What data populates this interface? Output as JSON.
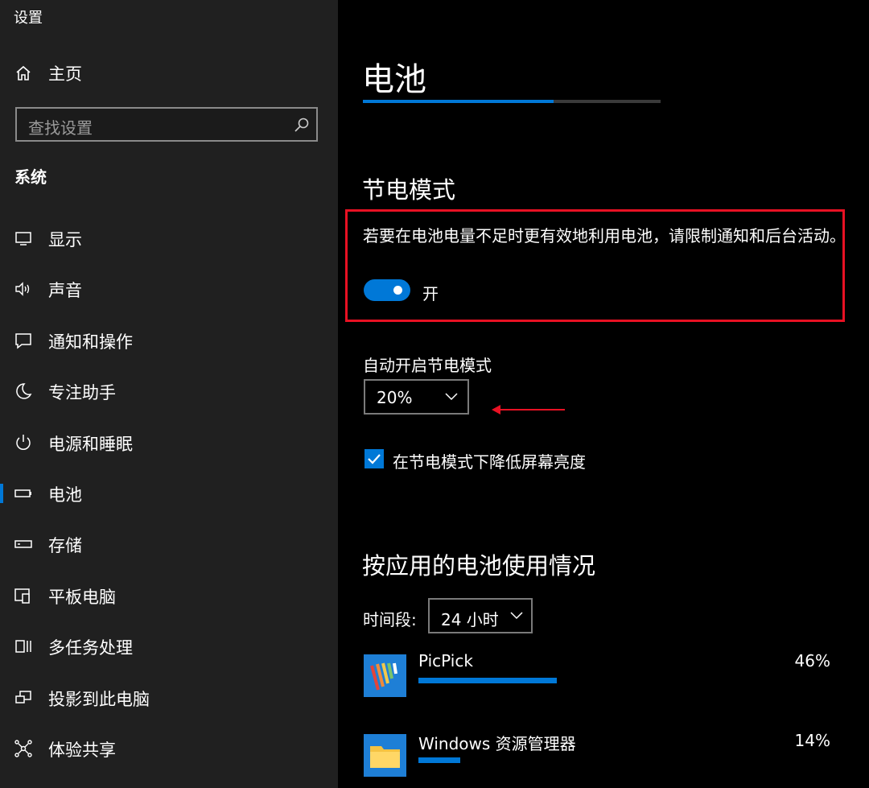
{
  "window": {
    "title": "设置"
  },
  "sidebar": {
    "home_label": "主页",
    "search_placeholder": "查找设置",
    "section": "系统",
    "items": [
      {
        "label": "显示",
        "icon": "display-icon"
      },
      {
        "label": "声音",
        "icon": "sound-icon"
      },
      {
        "label": "通知和操作",
        "icon": "notification-icon"
      },
      {
        "label": "专注助手",
        "icon": "moon-icon"
      },
      {
        "label": "电源和睡眠",
        "icon": "power-icon"
      },
      {
        "label": "电池",
        "icon": "battery-icon",
        "selected": true
      },
      {
        "label": "存储",
        "icon": "storage-icon"
      },
      {
        "label": "平板电脑",
        "icon": "tablet-icon"
      },
      {
        "label": "多任务处理",
        "icon": "multitask-icon"
      },
      {
        "label": "投影到此电脑",
        "icon": "project-icon"
      },
      {
        "label": "体验共享",
        "icon": "share-icon"
      }
    ]
  },
  "main": {
    "title": "电池",
    "battery_level_fraction": 0.64,
    "saver": {
      "heading": "节电模式",
      "description": "若要在电池电量不足时更有效地利用电池，请限制通知和后台活动。",
      "toggle_state": "开",
      "auto_label": "自动开启节电模式",
      "auto_value": "20%",
      "dim_label": "在节电模式下降低屏幕亮度",
      "dim_checked": true
    },
    "usage": {
      "heading": "按应用的电池使用情况",
      "period_label": "时间段:",
      "period_value": "24 小时",
      "apps": [
        {
          "name": "PicPick",
          "percent": "46%",
          "value": 0.46
        },
        {
          "name": "Windows 资源管理器",
          "percent": "14%",
          "value": 0.14
        }
      ]
    }
  },
  "colors": {
    "accent": "#0078d7",
    "highlight": "#e81123",
    "sidebar_bg": "#202020"
  }
}
